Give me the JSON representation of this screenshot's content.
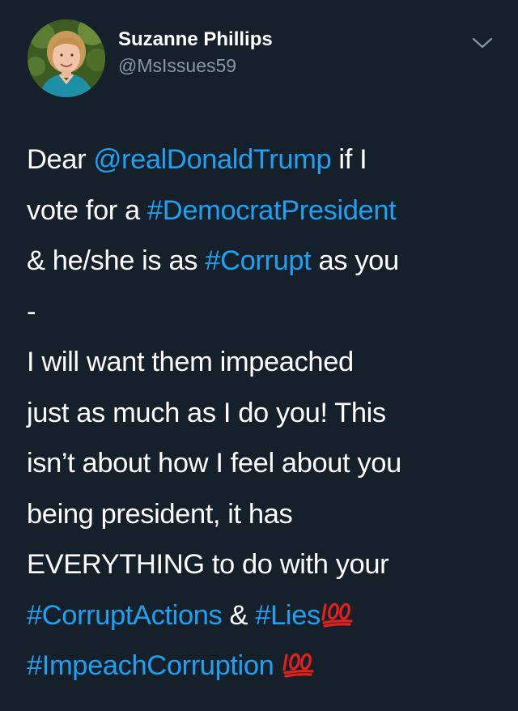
{
  "user": {
    "display_name": "Suzanne Phillips",
    "handle": "@MsIssues59"
  },
  "tweet": {
    "segments": {
      "l1_a": "Dear ",
      "mention": "@realDonaldTrump",
      "l1_b": " if I",
      "l2_a": "vote for a ",
      "tag_democrat": "#DemocratPresident",
      "l3_a": "& he/she is as ",
      "tag_corrupt": "#Corrupt",
      "l3_b": " as you",
      "l4": "-",
      "l5": "I will want them impeached",
      "l6": "just as much as I do you! This",
      "l7": "isn’t about how I feel about you",
      "l8": "being president, it has",
      "l9": "EVERYTHING to do with your",
      "tag_actions": "#CorruptActions",
      "l10_mid": " & ",
      "tag_lies": "#Lies",
      "tag_impeach": "#ImpeachCorruption",
      "l11_space": " "
    },
    "emoji": [
      "hundred-points-emoji",
      "hundred-points-emoji"
    ]
  },
  "colors": {
    "background": "#15202b",
    "text": "#ffffff",
    "link": "#1da1f2",
    "secondary": "#8899a6",
    "emoji": "#e0211c"
  },
  "icons": {
    "menu": "chevron-down-icon"
  }
}
